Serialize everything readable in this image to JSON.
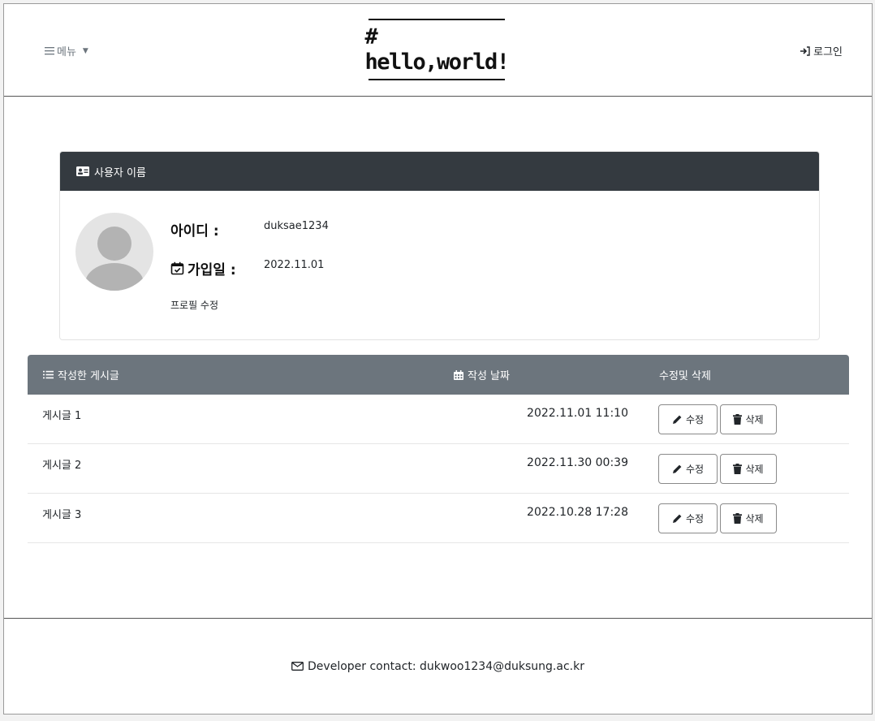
{
  "header": {
    "menu_label": "메뉴",
    "logo_text": "# hello,world!",
    "login_label": "로그인"
  },
  "profile": {
    "card_title": "사용자 이름",
    "id_label": "아이디 :",
    "id_value": "duksae1234",
    "joined_label": "가입일 :",
    "joined_value": "2022.11.01",
    "edit_profile_label": "프로필 수정"
  },
  "posts": {
    "headers": [
      "작성한 게시글",
      "작성 날짜",
      "수정및 삭제"
    ],
    "rows": [
      {
        "title": "게시글 1",
        "date": "2022.11.01 11:10"
      },
      {
        "title": "게시글 2",
        "date": "2022.11.30 00:39"
      },
      {
        "title": "게시글 3",
        "date": "2022.10.28 17:28"
      }
    ],
    "edit_label": "수정",
    "delete_label": "삭제"
  },
  "footer": {
    "contact": "Developer contact: dukwoo1234@duksung.ac.kr"
  },
  "icons": {
    "menu": "list-icon",
    "login": "sign-in-icon",
    "card_head": "id-card-icon",
    "joined": "calendar-check-icon",
    "posts_header": "list-ul-icon",
    "date_header": "calendar-icon",
    "edit": "pencil-icon",
    "delete": "trash-icon",
    "contact": "envelope-icon"
  },
  "colors": {
    "card_header": "#343a40",
    "table_header": "#6c757d"
  }
}
